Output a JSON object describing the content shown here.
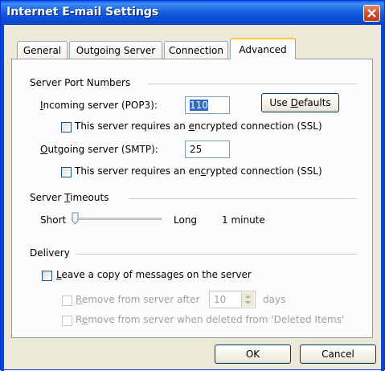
{
  "window": {
    "title": "Internet E-mail Settings"
  },
  "tabs": [
    {
      "label": "General"
    },
    {
      "label": "Outgoing Server"
    },
    {
      "label": "Connection"
    },
    {
      "label": "Advanced"
    }
  ],
  "server_ports": {
    "group_label": "Server Port Numbers",
    "incoming_label": "Incoming server (POP3):",
    "incoming_value": "110",
    "use_defaults": "Use Defaults",
    "incoming_ssl_label": "This server requires an encrypted connection (SSL)",
    "incoming_ssl_checked": false,
    "outgoing_label": "Outgoing server (SMTP):",
    "outgoing_value": "25",
    "outgoing_ssl_label": "This server requires an encrypted connection (SSL)",
    "outgoing_ssl_checked": false
  },
  "timeouts": {
    "group_label": "Server Timeouts",
    "short_label": "Short",
    "long_label": "Long",
    "value_text": "1 minute",
    "slider_level": 0.0
  },
  "delivery": {
    "group_label": "Delivery",
    "leave_copy_label": "Leave a copy of messages on the server",
    "leave_copy_checked": false,
    "remove_after_label": "Remove from server after",
    "remove_after_value": "10",
    "days_label": "days",
    "remove_deleted_label": "Remove from server when deleted from 'Deleted Items'"
  },
  "footer": {
    "ok": "OK",
    "cancel": "Cancel"
  }
}
